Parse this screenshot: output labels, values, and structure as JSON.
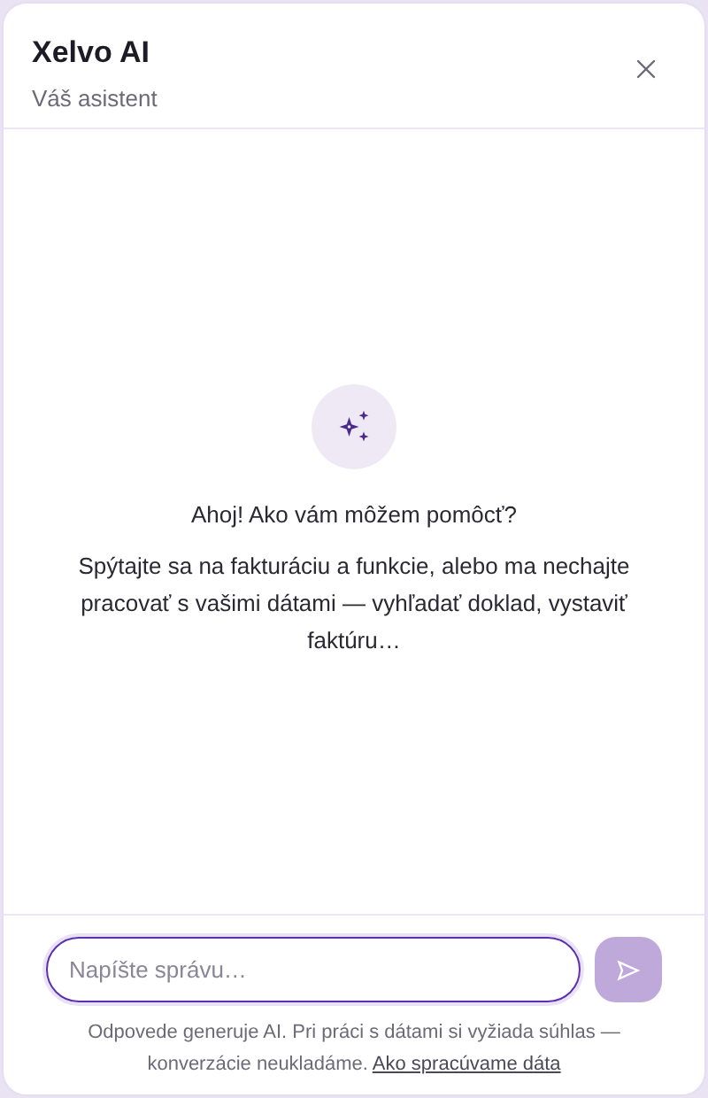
{
  "header": {
    "title": "Xelvo AI",
    "subtitle": "Váš asistent"
  },
  "empty_state": {
    "heading": "Ahoj! Ako vám môžem pomôcť?",
    "text": "Spýtajte sa na fakturáciu a funkcie, alebo ma nechajte pracovať s vašimi dátami — vyhľadať doklad, vystaviť faktúru…"
  },
  "composer": {
    "placeholder": "Napíšte správu…",
    "send_disabled": true
  },
  "disclaimer": {
    "text": "Odpovede generuje AI. Pri práci s dátami si vyžiada súhlas — konverzácie neukladáme.",
    "link": "Ako spracúvame dáta"
  }
}
